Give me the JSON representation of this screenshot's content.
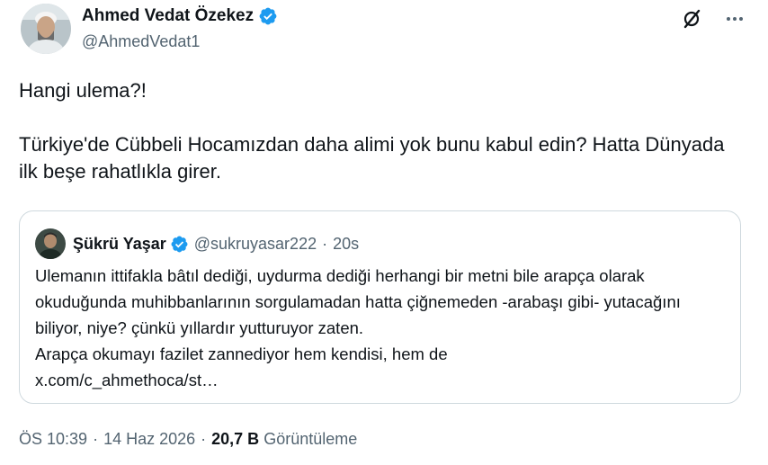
{
  "author": {
    "name": "Ahmed Vedat Özekez",
    "handle": "@AhmedVedat1",
    "verified": true
  },
  "tweet": {
    "lines": [
      "Hangi ulema?!",
      "Türkiye'de Cübbeli Hocamızdan daha alimi yok bunu kabul edin? Hatta Dünyada ilk beşe rahatlıkla girer."
    ]
  },
  "quote": {
    "name": "Şükrü Yaşar",
    "handle": "@sukruyasar222",
    "dot": "·",
    "time": "20s",
    "verified": true,
    "lines": [
      "Ulemanın ittifakla bâtıl dediği, uydurma dediği herhangi bir metni bile arapça olarak okuduğunda muhibbanlarının sorgulamadan hatta çiğnemeden -arabaşı gibi- yutacağını biliyor, niye? çünkü yıllardır yutturuyor zaten.",
      "Arapça okumayı fazilet zannediyor hem kendisi, hem de",
      "x.com/c_ahmethoca/st…"
    ]
  },
  "meta": {
    "time": "ÖS 10:39",
    "sep": "·",
    "date": "14 Haz 2026",
    "views_count": "20,7 B",
    "views_label": "Görüntüleme"
  },
  "icons": {
    "verified": "verified-badge-icon",
    "grok": "grok-icon",
    "more": "more-icon"
  },
  "colors": {
    "verified_blue": "#1d9bf0",
    "text_primary": "#0f1419",
    "text_secondary": "#536471",
    "border": "#cfd9de"
  }
}
